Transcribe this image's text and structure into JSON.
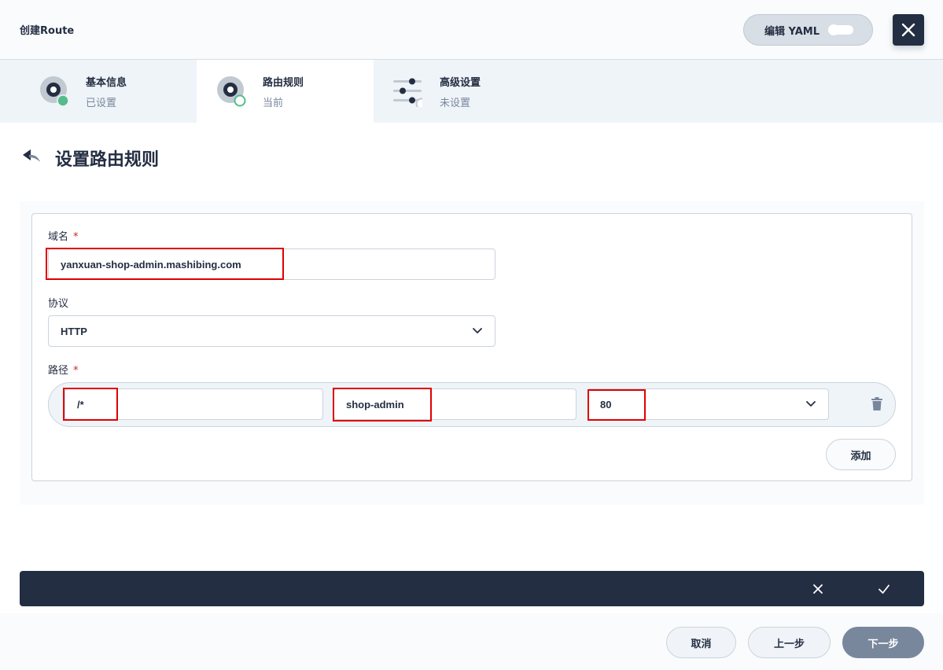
{
  "header": {
    "title": "创建Route",
    "yaml_label": "编辑 YAML"
  },
  "steps": [
    {
      "title": "基本信息",
      "status": "已设置"
    },
    {
      "title": "路由规则",
      "status": "当前"
    },
    {
      "title": "高级设置",
      "status": "未设置"
    }
  ],
  "section": {
    "title": "设置路由规则"
  },
  "form": {
    "domain": {
      "label": "域名",
      "required_mark": "*",
      "value": "yanxuan-shop-admin.mashibing.com"
    },
    "protocol": {
      "label": "协议",
      "value": "HTTP"
    },
    "path": {
      "label": "路径",
      "required_mark": "*",
      "rows": [
        {
          "path": "/*",
          "service": "shop-admin",
          "port": "80"
        }
      ]
    },
    "add_label": "添加"
  },
  "footer": {
    "cancel_label": "取消",
    "prev_label": "上一步",
    "next_label": "下一步"
  },
  "colors": {
    "dark": "#242e42",
    "success": "#55bc8a",
    "highlight": "#e00000",
    "required": "#ca2621"
  },
  "icons": {
    "close": "close-icon",
    "back": "back-arrow-icon",
    "chevron": "chevron-down-icon",
    "trash": "trash-icon",
    "bar_cancel": "close-icon",
    "bar_confirm": "check-icon"
  }
}
